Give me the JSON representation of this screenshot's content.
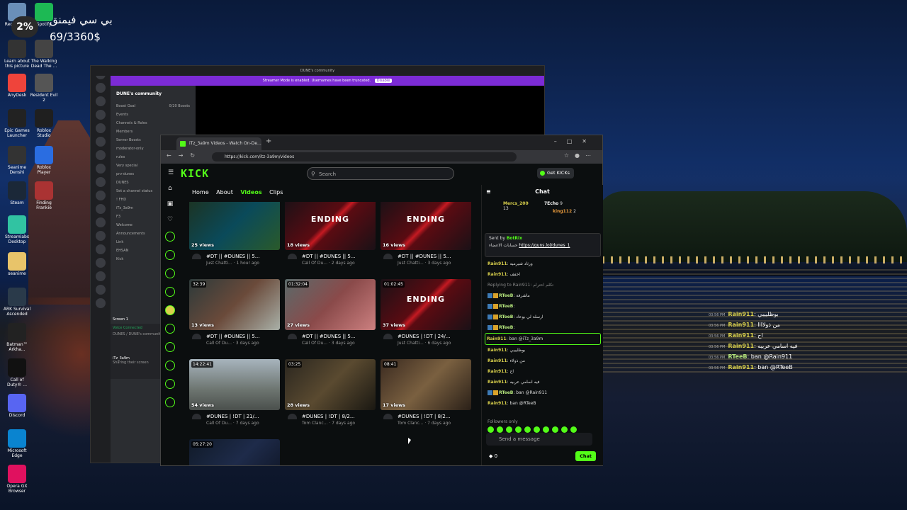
{
  "overlay": {
    "percent": "2%",
    "line1": "بي سي فيمنق",
    "line2": "69/3360$"
  },
  "desktop_icons": [
    {
      "label": "Recycle Bin",
      "icon": "recycle-bin-icon",
      "color": "#6a8fb8"
    },
    {
      "label": "Spotify",
      "icon": "spotify-icon",
      "color": "#1db954"
    },
    {
      "label": "Learn about this picture",
      "icon": "info-icon",
      "color": "#333"
    },
    {
      "label": "The Walking Dead The ...",
      "icon": "game-icon",
      "color": "#444"
    },
    {
      "label": "AnyDesk",
      "icon": "anydesk-icon",
      "color": "#ef443b"
    },
    {
      "label": "Resident Evil 2",
      "icon": "game-icon",
      "color": "#555"
    },
    {
      "label": "Epic Games Launcher",
      "icon": "epic-icon",
      "color": "#222"
    },
    {
      "label": "Roblox Studio",
      "icon": "roblox-icon",
      "color": "#1f1f1f"
    },
    {
      "label": "Seanime Denshi",
      "icon": "app-icon",
      "color": "#333"
    },
    {
      "label": "Roblox Player",
      "icon": "roblox-icon",
      "color": "#2a6de1"
    },
    {
      "label": "Steam",
      "icon": "steam-icon",
      "color": "#1b2838"
    },
    {
      "label": "Finding Frankie",
      "icon": "game-icon",
      "color": "#a33"
    },
    {
      "label": "Streamlabs Desktop",
      "icon": "streamlabs-icon",
      "color": "#31c3a2"
    },
    {
      "label": "seanime",
      "icon": "folder-icon",
      "color": "#e8c46a"
    },
    {
      "label": "ARK Survival Ascended",
      "icon": "game-icon",
      "color": "#2a3a4a"
    },
    {
      "label": "Batman™ Arkha...",
      "icon": "game-icon",
      "color": "#222"
    },
    {
      "label": "Call of Duty® ...",
      "icon": "game-icon",
      "color": "#111"
    },
    {
      "label": "Discord",
      "icon": "discord-icon",
      "color": "#5865f2"
    },
    {
      "label": "Microsoft Edge",
      "icon": "edge-icon",
      "color": "#0a84d0"
    },
    {
      "label": "Opera GX Browser",
      "icon": "opera-icon",
      "color": "#e0115f"
    }
  ],
  "discord": {
    "title": "DUNE's community",
    "banner": "Streamer Mode is enabled. Usernames have been truncated.",
    "banner_btn": "Disable",
    "server": "DUNE's community",
    "boost": "Boost Goal",
    "boost_count": "0/20 Boosts",
    "channels": [
      "Events",
      "Channels & Roles",
      "Members",
      "Server Boosts",
      "moderator-only",
      "rules",
      "Very special",
      "prv-dunes",
      "DUNES",
      "Set a channel status",
      "! FHD",
      "iTz_3a9m",
      "F3",
      "Welcome",
      "Announcements",
      "Link",
      "EHSAN",
      "Kick"
    ],
    "screen": "Screen 1",
    "voice": "Voice Connected",
    "voice_sub": "DUNES / DUNE's community",
    "user": "iTz_3a9m",
    "user_status": "Sharing their screen"
  },
  "browser": {
    "tab": "iTz_3a9m Videos - Watch On-De...",
    "url": "https://kick.com/itz-3a9m/videos"
  },
  "kick": {
    "logo": "KICK",
    "search_placeholder": "Search",
    "get_kicks": "Get KICKs",
    "tabs": [
      "Home",
      "About",
      "Videos",
      "Clips"
    ],
    "videos": [
      {
        "dur": "",
        "views": "25 views",
        "title": "#DT || #DUNES || 5...",
        "meta": "Just Chatti... · 1 hour ago",
        "thumb": "tg",
        "ending": false
      },
      {
        "dur": "",
        "views": "18 views",
        "title": "#DT || #DUNES || 5...",
        "meta": "Call Of Du... · 2 days ago",
        "thumb": "te",
        "ending": true
      },
      {
        "dur": "",
        "views": "16 views",
        "title": "#DT || #DUNES || 5...",
        "meta": "Just Chatti... · 3 days ago",
        "thumb": "te",
        "ending": true
      },
      {
        "dur": "32:39",
        "views": "13 views",
        "title": "#DT || #DUNES || 5...",
        "meta": "Call Of Du... · 3 days ago",
        "thumb": "tp",
        "ending": false
      },
      {
        "dur": "01:32:04",
        "views": "27 views",
        "title": "#DT || #DUNES || 5...",
        "meta": "Call Of Du... · 3 days ago",
        "thumb": "tc",
        "ending": false
      },
      {
        "dur": "01:02:45",
        "views": "37 views",
        "title": "#DUNES | !DT | 24/...",
        "meta": "Just Chatti... · 6 days ago",
        "thumb": "te",
        "ending": true
      },
      {
        "dur": "14:22:41",
        "views": "54 views",
        "title": "#DUNES | !DT | 21/...",
        "meta": "Call Of Du... · 7 days ago",
        "thumb": "ts",
        "ending": false
      },
      {
        "dur": "03:25",
        "views": "28 views",
        "title": "#DUNES | !DT | 8/2...",
        "meta": "Tom Clanc... · 7 days ago",
        "thumb": "tb",
        "ending": false
      },
      {
        "dur": "08:41",
        "views": "17 views",
        "title": "#DUNES | !DT | 8/2...",
        "meta": "Tom Clanc... · 7 days ago",
        "thumb": "tr",
        "ending": false
      },
      {
        "dur": "05:27:20",
        "views": "",
        "title": "",
        "meta": "",
        "thumb": "td",
        "ending": false
      }
    ],
    "ending_text": "ENDING",
    "chat": {
      "title": "Chat",
      "leader1": "Mercs_200",
      "leader1_count": "13",
      "leader2": "7Echo",
      "leader2_count": "9",
      "leader3": "king112",
      "leader3_count": "2",
      "pin_sender": "Sent by",
      "pin_bot": "BotRix",
      "pin_text": "حسابات الاعضاء",
      "pin_link": "https://guns.lol/dunes_1",
      "replying": "Replying to Rain911: تكلم احترام",
      "messages": [
        {
          "user": "Rain911",
          "text": "ورثاد شيرميه",
          "badges": 0
        },
        {
          "user": "Rain911",
          "text": "اخفف",
          "badges": 0
        },
        {
          "user": "RTeeB",
          "text": "ماشرفة",
          "badges": 2
        },
        {
          "user": "RTeeB",
          "text": "",
          "badges": 2
        },
        {
          "user": "RTeeB",
          "text": "ارسلة لي بوعاد",
          "badges": 2
        },
        {
          "user": "RTeeB",
          "text": "",
          "badges": 2
        },
        {
          "user": "Rain911",
          "text": "ban @iTz_3a9m",
          "badges": 0,
          "hl": true
        },
        {
          "user": "Rain911",
          "text": "بوظلييبي",
          "badges": 0
        },
        {
          "user": "Rain911",
          "text": "من ذولاء",
          "badges": 0
        },
        {
          "user": "Rain911",
          "text": "اح",
          "badges": 0
        },
        {
          "user": "Rain911",
          "text": "فيه اسامي عربيه",
          "badges": 0
        },
        {
          "user": "RTeeB",
          "text": "ban @Rain911",
          "badges": 2
        },
        {
          "user": "Rain911",
          "text": "ban @RTeeB",
          "badges": 0
        }
      ],
      "followers_only": "Followers only",
      "placeholder": "Send a message",
      "points": "0",
      "btn": "Chat"
    }
  },
  "overlay_chat": [
    {
      "time": "03:56 PM",
      "user": "Rain911",
      "text": "بوظلييبي",
      "color": "#d9d04c"
    },
    {
      "time": "03:56 PM",
      "user": "Rain911",
      "text": "من ذولاااا",
      "color": "#d9d04c"
    },
    {
      "time": "03:56 PM",
      "user": "Rain911",
      "text": "اح",
      "color": "#d9d04c"
    },
    {
      "time": "03:56 PM",
      "user": "Rain911",
      "text": "فيه اسامي عربيه",
      "color": "#d9d04c"
    },
    {
      "time": "03:56 PM",
      "user": "RTeeB",
      "text": "ban @Rain911",
      "color": "#b6e77d"
    },
    {
      "time": "03:56 PM",
      "user": "Rain911",
      "text": "ban @RTeeB",
      "color": "#d9d04c"
    }
  ]
}
